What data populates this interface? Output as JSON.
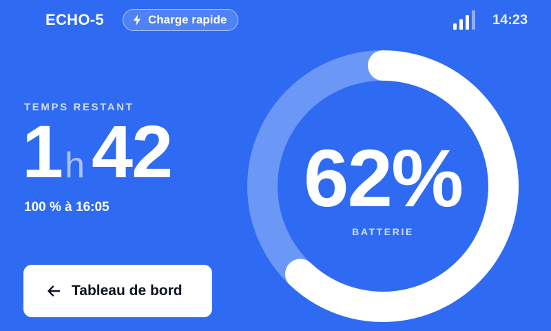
{
  "header": {
    "device_name": "ECHO-5",
    "mode_label": "Charge rapide",
    "mode_icon": "lightning-bolt-icon",
    "signal_icon": "signal-bars-icon",
    "signal_level": 0.75,
    "clock": "14:23"
  },
  "remaining": {
    "label": "TEMPS RESTANT",
    "hours": "1",
    "hours_unit": "h",
    "minutes": "42",
    "full_at": "100 % à 16:05"
  },
  "battery": {
    "value_text": "62%",
    "level": 0.62,
    "label": "BATTERIE"
  },
  "nav": {
    "back_label": "Tableau de bord",
    "back_icon": "arrow-left-icon"
  },
  "colors": {
    "background": "#2f6bf2",
    "ring_track": "#6b97f6",
    "ring_fill": "#ffffff",
    "accent_text": "#cfdcff"
  }
}
